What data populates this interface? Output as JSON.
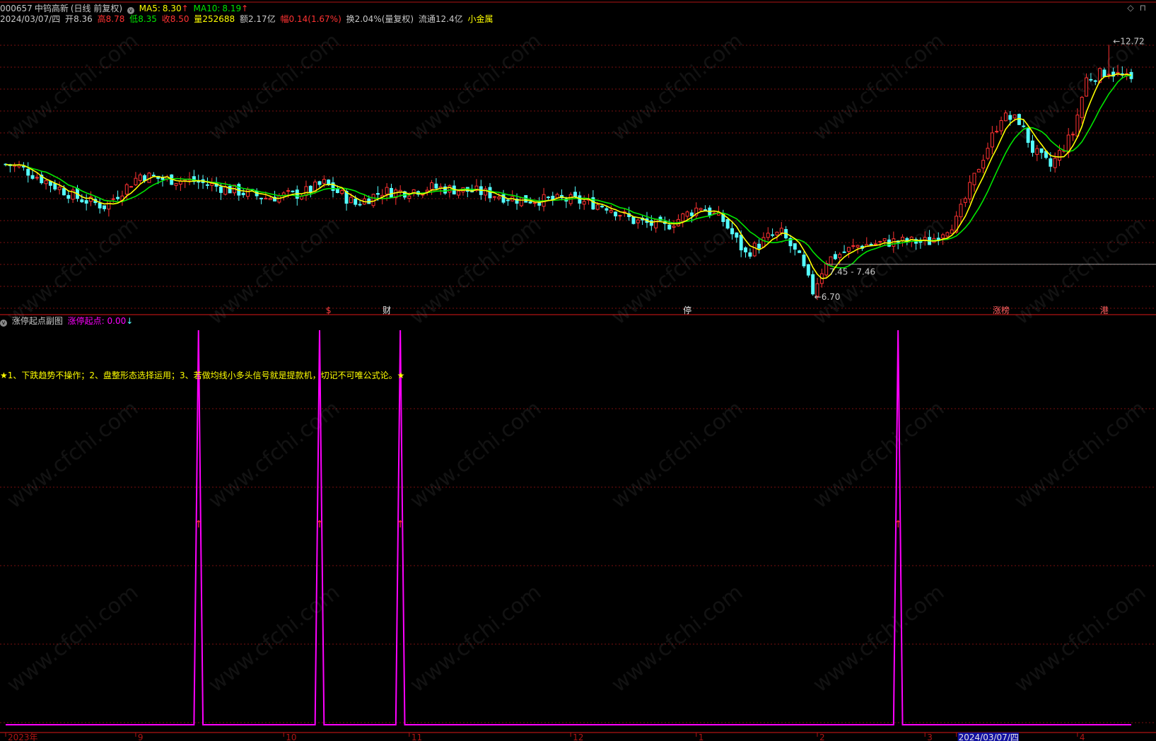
{
  "header": {
    "code": "000657",
    "name": "中钨高新",
    "mode": "(日线 前复权)",
    "ma5_label": "MA5:",
    "ma5_value": "8.30",
    "ma10_label": "MA10:",
    "ma10_value": "8.19",
    "date": "2024/03/07/四",
    "open_label": "开",
    "open": "8.36",
    "high_label": "高",
    "high": "8.78",
    "low_label": "低",
    "low": "8.35",
    "close_label": "收",
    "close": "8.50",
    "vol_label": "量",
    "vol": "252688",
    "amt_label": "额",
    "amt": "2.17亿",
    "chg_label": "幅",
    "chg": "0.14(1.67%)",
    "turnover": "换2.04%(量复权)",
    "float": "流通12.4亿",
    "sector": "小金属",
    "up_arrow": "↑",
    "collapse_icon": "v"
  },
  "sub_header": {
    "title": "涨停起点副图",
    "indicator_label": "涨停起点: 0.00",
    "down_arrow": "↓"
  },
  "top_right_icons": [
    "◇",
    "⊓"
  ],
  "note": "★1、下跌趋势不操作；2、盘整形态选择运用；3、若做均线小多头信号就是提款机，切记不可唯公式论。★",
  "price_annotations": {
    "high_mark": "12.72",
    "low_mark": "6.70",
    "level_text": "7.45 - 7.46",
    "level_value": 7.455
  },
  "event_markers": [
    {
      "bar": 72,
      "text": "$",
      "color": "#ff4040"
    },
    {
      "bar": 85,
      "text": "财",
      "color": "#e6e6e6"
    },
    {
      "bar": 152,
      "text": "停",
      "color": "#e6e6e6"
    },
    {
      "bar": 222,
      "text": "涨榜",
      "color": "#ff6060"
    },
    {
      "bar": 245,
      "text": "港",
      "color": "#ff6060"
    }
  ],
  "x_axis_labels": [
    {
      "bar": 0,
      "text": "2023年"
    },
    {
      "bar": 29,
      "text": "9"
    },
    {
      "bar": 62,
      "text": "10"
    },
    {
      "bar": 90,
      "text": "11"
    },
    {
      "bar": 126,
      "text": "12"
    },
    {
      "bar": 154,
      "text": "1"
    },
    {
      "bar": 181,
      "text": "2"
    },
    {
      "bar": 205,
      "text": "3"
    },
    {
      "bar": 212,
      "text": "2024/03/07/四",
      "highlight": true
    },
    {
      "bar": 239,
      "text": "4"
    }
  ],
  "colors": {
    "up": "#ff3232",
    "down": "#54ffff",
    "ma5": "#ffff00",
    "ma10": "#00e600",
    "signal": "#ff00ff",
    "grid": "#7a1010",
    "axis": "#b01414",
    "note": "#ffff00",
    "header_red": "#ff3232",
    "header_green": "#00e600",
    "header_yellow": "#ffff00",
    "indicator": "#ff00ff"
  },
  "chart_data": [
    {
      "type": "candlestick",
      "title": "",
      "count": 252,
      "ylim": [
        6.5,
        13.2
      ],
      "grid": true,
      "anchors": [
        {
          "bar": 0,
          "price": 9.85
        },
        {
          "bar": 3,
          "price": 9.8
        },
        {
          "bar": 8,
          "price": 9.5
        },
        {
          "bar": 16,
          "price": 9.05
        },
        {
          "bar": 22,
          "price": 8.85
        },
        {
          "bar": 30,
          "price": 9.6
        },
        {
          "bar": 35,
          "price": 9.5
        },
        {
          "bar": 42,
          "price": 9.45
        },
        {
          "bar": 52,
          "price": 9.2
        },
        {
          "bar": 58,
          "price": 9.05
        },
        {
          "bar": 66,
          "price": 9.15
        },
        {
          "bar": 71,
          "price": 9.4
        },
        {
          "bar": 78,
          "price": 8.9
        },
        {
          "bar": 84,
          "price": 9.2
        },
        {
          "bar": 89,
          "price": 9.2
        },
        {
          "bar": 95,
          "price": 9.3
        },
        {
          "bar": 105,
          "price": 9.2
        },
        {
          "bar": 115,
          "price": 9.0
        },
        {
          "bar": 126,
          "price": 9.0
        },
        {
          "bar": 134,
          "price": 8.85
        },
        {
          "bar": 140,
          "price": 8.5
        },
        {
          "bar": 147,
          "price": 8.35
        },
        {
          "bar": 155,
          "price": 8.85
        },
        {
          "bar": 160,
          "price": 8.5
        },
        {
          "bar": 165,
          "price": 7.7
        },
        {
          "bar": 170,
          "price": 8.1
        },
        {
          "bar": 173,
          "price": 8.2
        },
        {
          "bar": 177,
          "price": 7.6
        },
        {
          "bar": 180,
          "price": 6.8
        },
        {
          "bar": 183,
          "price": 7.55
        },
        {
          "bar": 190,
          "price": 7.9
        },
        {
          "bar": 198,
          "price": 8.0
        },
        {
          "bar": 206,
          "price": 8.0
        },
        {
          "bar": 212,
          "price": 8.5
        },
        {
          "bar": 217,
          "price": 9.8
        },
        {
          "bar": 222,
          "price": 11.0
        },
        {
          "bar": 226,
          "price": 10.9
        },
        {
          "bar": 229,
          "price": 10.2
        },
        {
          "bar": 233,
          "price": 9.8
        },
        {
          "bar": 238,
          "price": 10.6
        },
        {
          "bar": 241,
          "price": 11.9
        },
        {
          "bar": 246,
          "price": 12.1
        },
        {
          "bar": 251,
          "price": 11.85
        }
      ],
      "series": [
        {
          "name": "MA5"
        },
        {
          "name": "MA10"
        }
      ]
    },
    {
      "type": "line",
      "title": "",
      "series": [
        {
          "name": "涨停起点",
          "spikes": [
            43,
            70,
            88,
            199
          ],
          "value_when_off": 0,
          "value_when_on": 1
        }
      ],
      "ylim": [
        0,
        1
      ]
    }
  ]
}
